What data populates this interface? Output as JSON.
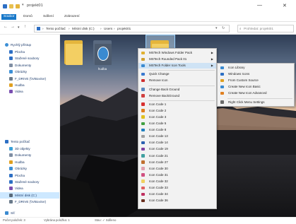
{
  "window": {
    "title": "projekt01",
    "minimize": "—",
    "close": "✕"
  },
  "ribbon": {
    "tabs": [
      "Soubor",
      "Domů",
      "Sdílení",
      "Zobrazení"
    ]
  },
  "address": {
    "path": [
      "Tento počítač",
      "Místní disk (C:)",
      "Users",
      "projekt01"
    ],
    "separator": "›",
    "search_placeholder": "Prohledat: projekt01"
  },
  "nav": {
    "quick_access": "Rychlý přístup",
    "items": [
      {
        "label": "Plocha",
        "color": "#2d6fc4"
      },
      {
        "label": "Stažené soubory",
        "color": "#2d6fc4"
      },
      {
        "label": "Dokumenty",
        "color": "#7f8ea3"
      },
      {
        "label": "Obrázky",
        "color": "#3c8fd6"
      },
      {
        "label": "F_DRIVE (\\\\VBoxSvr)",
        "color": "#6a7a8a"
      },
      {
        "label": "Hudba",
        "color": "#e0a020"
      },
      {
        "label": "Videa",
        "color": "#7a4fb0"
      }
    ],
    "this_pc": "Tento počítač",
    "pc_items": [
      {
        "label": "3D objekty",
        "color": "#3aa0d8"
      },
      {
        "label": "Dokumenty",
        "color": "#7f8ea3"
      },
      {
        "label": "Hudba",
        "color": "#e0a020"
      },
      {
        "label": "Obrázky",
        "color": "#3c8fd6"
      },
      {
        "label": "Plocha",
        "color": "#2d6fc4"
      },
      {
        "label": "Stažené soubory",
        "color": "#2d6fc4"
      },
      {
        "label": "Videa",
        "color": "#7a4fb0"
      },
      {
        "label": "Místní disk (C:)",
        "color": "#5a6a7a"
      },
      {
        "label": "F_DRIVE (\\\\VBoxSvr)",
        "color": "#6a7a8a"
      }
    ],
    "network": "Síť"
  },
  "folders": [
    {
      "label": ""
    },
    {
      "label": "hudba"
    },
    {
      "label": "obrázky"
    }
  ],
  "context_menu": {
    "items": [
      {
        "label": "MSTech Windows Folder Pack",
        "color": "#e0b030",
        "arrow": true
      },
      {
        "label": "MSTech Rounded Pack 01",
        "color": "#d0a030",
        "arrow": true
      },
      {
        "label": "MSTech Folder Icon Tools",
        "color": "#3a8ad0",
        "arrow": true
      },
      {
        "label": "Quick Change",
        "color": "#3a7ad0"
      },
      {
        "label": "Remove Icon",
        "color": "#d03030"
      },
      {
        "label": "Change Back Ground",
        "color": "#5a8ac0"
      },
      {
        "label": "Remove BackGround",
        "color": "#d04040"
      },
      {
        "label": "Icon Code 1",
        "color": "#d83030"
      },
      {
        "label": "Icon Code 2",
        "color": "#e08020"
      },
      {
        "label": "Icon Code 3",
        "color": "#e0c020"
      },
      {
        "label": "Icon Code 5",
        "color": "#40a040"
      },
      {
        "label": "Icon Code 8",
        "color": "#2080c0"
      },
      {
        "label": "Icon Code 13",
        "color": "#a0a0a0"
      },
      {
        "label": "Icon Code 14",
        "color": "#2a60b0"
      },
      {
        "label": "Icon Code 19",
        "color": "#8040a0"
      },
      {
        "label": "Icon Code 21",
        "color": "#40a0a0"
      },
      {
        "label": "Icon Code 27",
        "color": "#c07030"
      },
      {
        "label": "Icon Code 30",
        "color": "#e0a0b0"
      },
      {
        "label": "Icon Code 31",
        "color": "#d05080"
      },
      {
        "label": "Icon Code 32",
        "color": "#f0d060"
      },
      {
        "label": "Icon Code 33",
        "color": "#e06060"
      },
      {
        "label": "Icon Code 34",
        "color": "#c03060"
      },
      {
        "label": "Icon Code 36",
        "color": "#6a3020"
      }
    ]
  },
  "submenu": {
    "items": [
      {
        "label": "Icon Library",
        "color": "#3a8ad0"
      },
      {
        "label": "Windows Icons",
        "color": "#2d6fc4"
      },
      {
        "label": "From Custom Source",
        "color": "#e0a020"
      },
      {
        "label": "Create New Icon Basic",
        "color": "#3a8ad0"
      },
      {
        "label": "Create New Icon Advanced",
        "color": "#e08020"
      },
      {
        "label": "Right Click Menu Settings",
        "color": "#6a6a6a"
      }
    ]
  },
  "status": {
    "items_count": "Počet položek: 3",
    "selected": "Vybrána položka: 1",
    "details": "Stav: ✓ Sdíleno"
  }
}
